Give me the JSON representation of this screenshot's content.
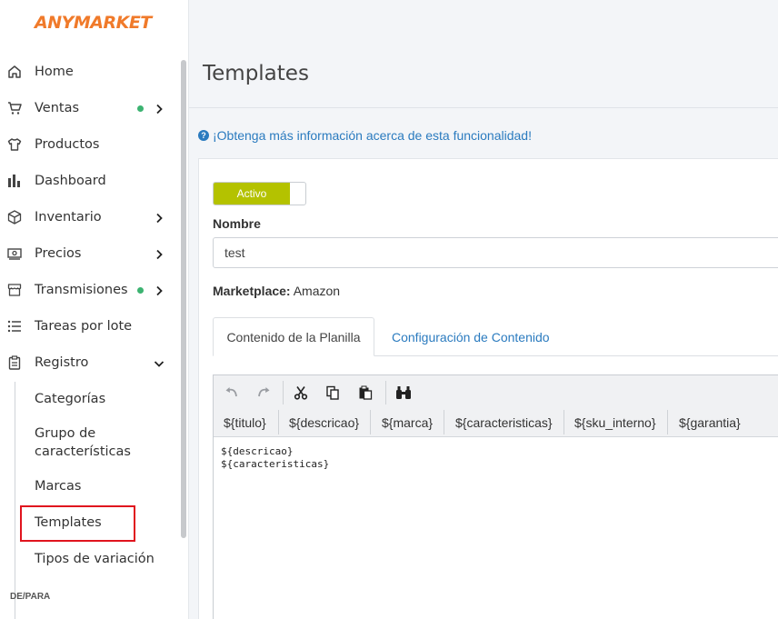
{
  "app": {
    "logo": "ANYMARKET"
  },
  "sidebar": {
    "items": [
      {
        "label": "Home",
        "icon": "home-icon"
      },
      {
        "label": "Ventas",
        "icon": "cart-icon",
        "dot": true,
        "chevron": "right"
      },
      {
        "label": "Productos",
        "icon": "shirt-icon"
      },
      {
        "label": "Dashboard",
        "icon": "bar-chart-icon"
      },
      {
        "label": "Inventario",
        "icon": "box-icon",
        "chevron": "right"
      },
      {
        "label": "Precios",
        "icon": "money-icon",
        "chevron": "right"
      },
      {
        "label": "Transmisiones",
        "icon": "store-icon",
        "dot": true,
        "chevron": "right"
      },
      {
        "label": "Tareas por lote",
        "icon": "list-icon"
      },
      {
        "label": "Registro",
        "icon": "clipboard-icon",
        "chevron": "down"
      }
    ],
    "sub_items": {
      "categorias": "Categorías",
      "grupo_line1": "Grupo de",
      "grupo_line2": "características",
      "marcas": "Marcas",
      "templates": "Templates",
      "tipos": "Tipos de variación"
    },
    "section_label": "DE/PARA",
    "status_dot_color": "#3cb371",
    "highlight_color": "#e0141e"
  },
  "main": {
    "title": "Templates",
    "info_link": "¡Obtenga más información acerca de esta funcionalidad!",
    "toggle_label": "Activo",
    "toggle_color": "#b4c200",
    "nombre_label": "Nombre",
    "nombre_value": "test",
    "marketplace_label": "Marketplace:",
    "marketplace_value": "Amazon",
    "tabs": [
      {
        "label": "Contenido de la Planilla",
        "active": true
      },
      {
        "label": "Configuración de Contenido",
        "active": false
      }
    ],
    "editor": {
      "toolbar_icons": [
        "undo-icon",
        "redo-icon",
        "cut-icon",
        "copy-icon",
        "paste-icon",
        "find-icon"
      ],
      "variables": [
        "${titulo}",
        "${descricao}",
        "${marca}",
        "${caracteristicas}",
        "${sku_interno}",
        "${garantia}"
      ],
      "content": "${descricao}\n${caracteristicas}"
    },
    "link_color": "#2b7bbf"
  }
}
